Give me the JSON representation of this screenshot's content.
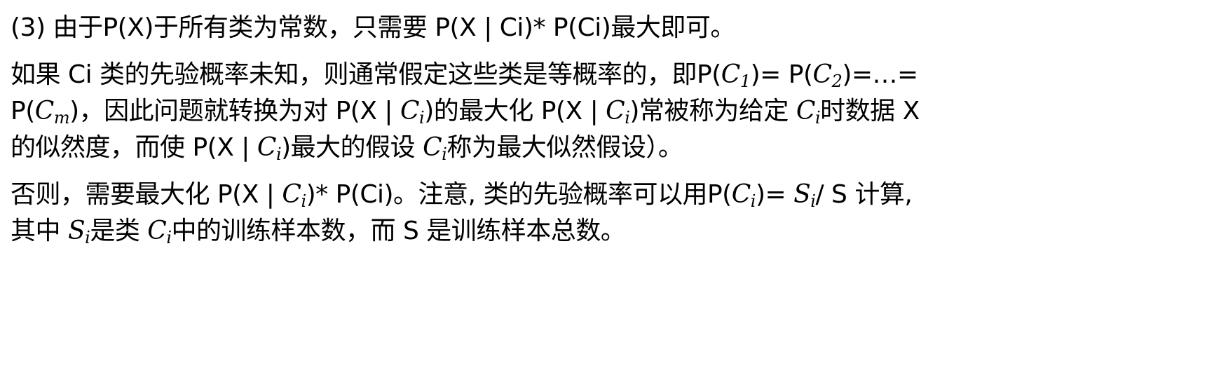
{
  "paragraph1": {
    "line1": "(3) 由于P(X)于所有类为常数，只需要 P(X | Ci)* P(Ci)最大即可。"
  },
  "paragraph2": {
    "line1": {
      "t1": "如果 Ci 类的先验概率未知，则通常假定这些类是等概率的，即P(",
      "m1": "C",
      "m1_sub": "1",
      "t2": ")= P(",
      "m2": "C",
      "m2_sub": "2",
      "t3": ")=…="
    },
    "line2": {
      "t1": "P(",
      "m1": "C",
      "m1_sub": "m",
      "t2": ")，因此问题就转换为对 P(X | ",
      "m2": "C",
      "m2_sub": "i",
      "t3": ")的最大化 P(X | ",
      "m3": "C",
      "m3_sub": "i",
      "t4": ")常被称为给定 ",
      "m4": "C",
      "m4_sub": "i",
      "t5": "时数据 X"
    },
    "line3": {
      "t1": "的似然度，而使 P(X | ",
      "m1": "C",
      "m1_sub": "i",
      "t2": ")最大的假设 ",
      "m2": "C",
      "m2_sub": "i",
      "t3": "称为最大似然假设）。"
    }
  },
  "paragraph3": {
    "line1": {
      "t1": "否则，需要最大化 P(X | ",
      "m1": "C",
      "m1_sub": "i",
      "t2": ")* P(Ci)。注意, 类的先验概率可以用P(",
      "m2": "C",
      "m2_sub": "i",
      "t3": ")= ",
      "m3": "S",
      "m3_sub": "i",
      "t4": "/ S 计算,"
    },
    "line2": {
      "t1": "其中 ",
      "m1": "S",
      "m1_sub": "i",
      "t2": "是类 ",
      "m2": "C",
      "m2_sub": "i",
      "t3": "中的训练样本数，而 S 是训练样本总数。"
    }
  }
}
